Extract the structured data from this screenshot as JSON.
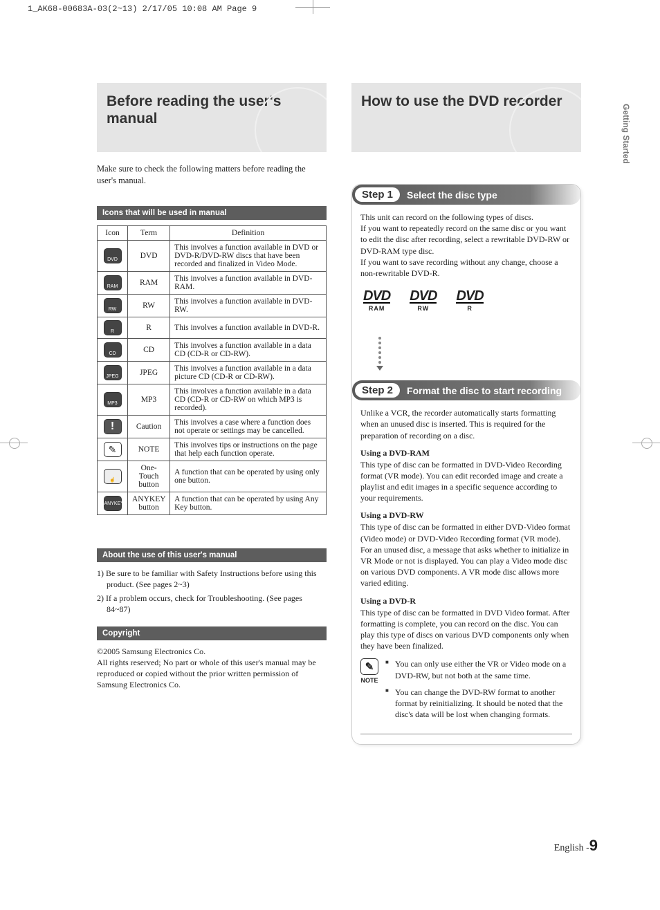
{
  "print_header": "1_AK68-00683A-03(2~13)  2/17/05  10:08 AM  Page 9",
  "side_tab": "Getting Started",
  "left": {
    "hero_title": "Before reading the user's manual",
    "intro_text": "Make sure to check the following matters before reading the user's manual.",
    "icons_header": "Icons that will be used in manual",
    "table_headers": {
      "icon": "Icon",
      "term": "Term",
      "def": "Definition"
    },
    "rows": [
      {
        "icon_label": "DVD",
        "term": "DVD",
        "def": "This involves a function available in DVD or DVD-R/DVD-RW discs that have been recorded and finalized in Video Mode."
      },
      {
        "icon_label": "RAM",
        "term": "RAM",
        "def": "This involves a function available in DVD-RAM."
      },
      {
        "icon_label": "RW",
        "term": "RW",
        "def": "This involves a function available in DVD-RW."
      },
      {
        "icon_label": "R",
        "term": "R",
        "def": "This involves a function available in DVD-R."
      },
      {
        "icon_label": "CD",
        "term": "CD",
        "def": "This involves a function available in a data CD (CD-R or CD-RW)."
      },
      {
        "icon_label": "JPEG",
        "term": "JPEG",
        "def": "This involves a function available in a data picture CD (CD-R or CD-RW)."
      },
      {
        "icon_label": "MP3",
        "term": "MP3",
        "def": "This involves a function available in a data CD (CD-R or CD-RW on which MP3 is recorded)."
      },
      {
        "icon_label": "!",
        "term": "Caution",
        "def": "This involves a case where a function does not operate or settings may be cancelled."
      },
      {
        "icon_label": "✎",
        "term": "NOTE",
        "def": "This involves tips or instructions on the page that help each function operate."
      },
      {
        "icon_label": "☝",
        "term": "One-Touch button",
        "def": "A function that can be operated by using only one button."
      },
      {
        "icon_label": "ANYKEY",
        "term": "ANYKEY button",
        "def": "A function that can be operated by using Any Key button."
      }
    ],
    "about_header": "About the use of this user's manual",
    "about_items": [
      "1) Be sure to be familiar with Safety Instructions before using this product. (See pages 2~3)",
      "2) If a problem occurs, check for Troubleshooting. (See pages 84~87)"
    ],
    "copyright_header": "Copyright",
    "copyright_body": "©2005 Samsung Electronics Co.\nAll rights reserved; No part or whole of this user's manual may be reproduced or copied without the prior written permission of Samsung Electronics Co."
  },
  "right": {
    "hero_title": "How to use the DVD recorder",
    "steps": [
      {
        "pill": "Step 1",
        "label": "Select the disc type",
        "body": "This unit can record on the following types of discs.\nIf you want to repeatedly record on the same disc or you want to edit the disc after recording, select a rewritable DVD-RW or DVD-RAM type disc.\nIf you want to save recording without any change, choose a non-rewritable DVD-R.",
        "logos": [
          {
            "word": "DVD",
            "sub": "RAM"
          },
          {
            "word": "DVD",
            "sub": "RW"
          },
          {
            "word": "DVD",
            "sub": "R"
          }
        ]
      },
      {
        "pill": "Step 2",
        "label": "Format the disc to start recording",
        "body": "Unlike a VCR, the recorder automatically starts formatting when an unused disc is inserted. This is required for the preparation of recording on a disc.",
        "subsections": [
          {
            "heading": "Using a DVD-RAM",
            "text": "This type of disc can be formatted in DVD-Video Recording format (VR mode). You can edit recorded image and create a playlist and edit images in a specific sequence according to your requirements."
          },
          {
            "heading": "Using a DVD-RW",
            "text": "This type of disc can be formatted in either DVD-Video format (Video mode) or DVD-Video Recording format (VR mode). For an unused disc, a message that asks whether to initialize in VR Mode or not is displayed. You can play a Video mode disc on various DVD components. A VR mode disc allows more varied editing."
          },
          {
            "heading": "Using a DVD-R",
            "text": "This type of disc can be formatted in DVD Video format. After formatting is complete, you can record on the disc. You can play this type of discs on various DVD components only when they have been finalized."
          }
        ],
        "note_label": "NOTE",
        "notes": [
          "You can only use either the VR or Video mode on a DVD-RW, but not both at the same time.",
          "You can change the DVD-RW format to another format by reinitializing. It should be noted that the disc's data will be lost when changing formats."
        ]
      }
    ]
  },
  "page_footer": {
    "lang": "English -",
    "num": "9"
  }
}
